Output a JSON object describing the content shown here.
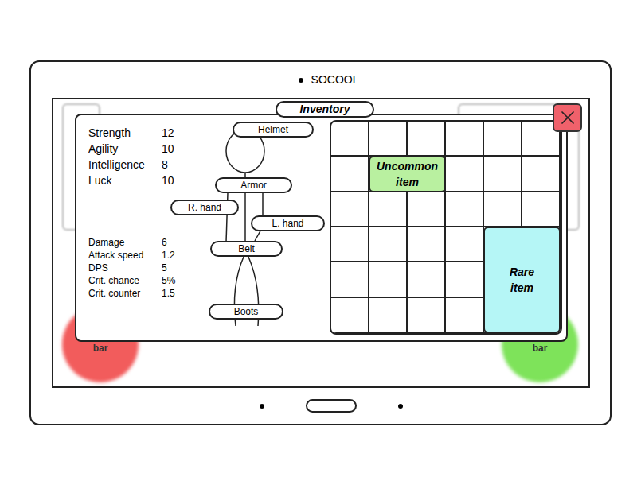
{
  "device": {
    "brand": "SOCOOL"
  },
  "hud": {
    "bars": [
      {
        "label": "bar",
        "color": "#f25c5c"
      },
      {
        "label": "bar",
        "color": "#7ee35a"
      }
    ]
  },
  "inventory": {
    "title": "Inventory"
  },
  "attributes": [
    {
      "name": "Strength",
      "value": "12"
    },
    {
      "name": "Agility",
      "value": "10"
    },
    {
      "name": "Intelligence",
      "value": "8"
    },
    {
      "name": "Luck",
      "value": "10"
    }
  ],
  "combat_stats": [
    {
      "name": "Damage",
      "value": "6"
    },
    {
      "name": "Attack speed",
      "value": "1.2"
    },
    {
      "name": "DPS",
      "value": "5"
    },
    {
      "name": "Crit. chance",
      "value": "5%"
    },
    {
      "name": "Crit. counter",
      "value": "1.5"
    }
  ],
  "equipment_slots": [
    {
      "label": "Helmet"
    },
    {
      "label": "Armor"
    },
    {
      "label": "R. hand"
    },
    {
      "label": "L. hand"
    },
    {
      "label": "Belt"
    },
    {
      "label": "Boots"
    }
  ],
  "grid": {
    "columns": 6,
    "rows": 6
  },
  "items": [
    {
      "name": "Uncommon item",
      "color": "#b9f0a0",
      "col": 2,
      "row": 2,
      "width": 2,
      "height": 1
    },
    {
      "name": "Rare item",
      "color": "#b5f6f6",
      "col": 5,
      "row": 4,
      "width": 2,
      "height": 3
    }
  ]
}
